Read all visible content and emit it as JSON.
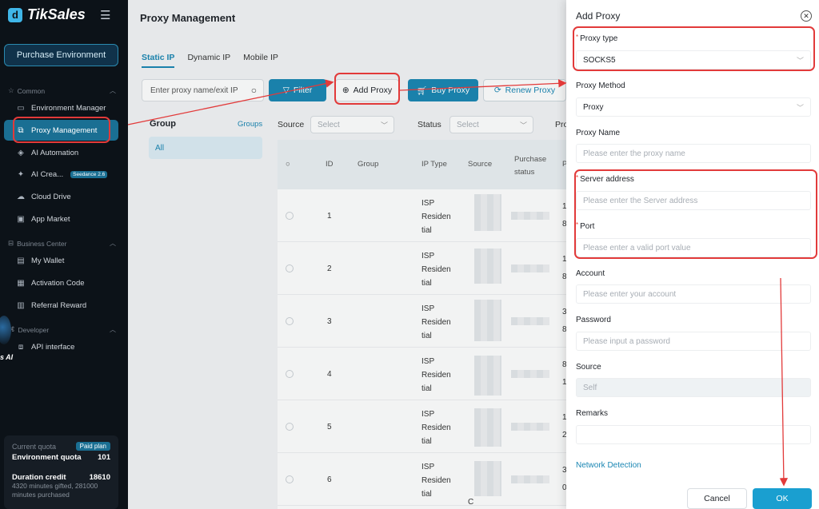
{
  "sidebar": {
    "brand": "TikSales",
    "purchase_button": "Purchase Environment",
    "sections": {
      "common": "Common",
      "business": "Business Center",
      "developer": "Developer"
    },
    "items": {
      "environment": "Environment Manager",
      "proxy": "Proxy Management",
      "ai_automation": "AI Automation",
      "ai_creation": "AI Crea...",
      "ai_creation_badge": "Seedance 2.6",
      "cloud_drive": "Cloud Drive",
      "app_market": "App Market",
      "wallet": "My Wallet",
      "activation": "Activation Code",
      "referral": "Referral Reward",
      "api": "API interface"
    },
    "deco_text": "s AI",
    "quota": {
      "current_label": "Current quota",
      "plan_badge": "Paid plan",
      "env_label": "Environment quota",
      "env_value": "101",
      "duration_label": "Duration credit",
      "duration_value": "18610",
      "duration_detail": "4320 minutes gifted, 281000 minutes purchased"
    }
  },
  "main": {
    "title": "Proxy Management",
    "tabs": [
      "Static IP",
      "Dynamic IP",
      "Mobile IP"
    ],
    "search_placeholder": "Enter proxy name/exit IP",
    "buttons": {
      "filter": "Filter",
      "add_proxy": "Add Proxy",
      "buy_proxy": "Buy Proxy",
      "renew_proxy": "Renew Proxy"
    },
    "group": {
      "title": "Group",
      "link": "Groups",
      "all": "All"
    },
    "filters": {
      "source_label": "Source",
      "source_placeholder": "Select",
      "status_label": "Status",
      "status_placeholder": "Select",
      "pro_label": "Pro"
    },
    "table": {
      "headers": {
        "id": "ID",
        "group": "Group",
        "ip_type": "IP Type",
        "source": "Source",
        "purchase": "Purchase status",
        "p": "P"
      },
      "rows": [
        {
          "id": "1",
          "ip_type": [
            "ISP",
            "Residen",
            "tial"
          ],
          "extra": ""
        },
        {
          "id": "2",
          "ip_type": [
            "ISP",
            "Residen",
            "tial"
          ],
          "extra": ""
        },
        {
          "id": "3",
          "ip_type": [
            "ISP",
            "Residen",
            "tial"
          ],
          "extra": ""
        },
        {
          "id": "4",
          "ip_type": [
            "ISP",
            "Residen",
            "tial"
          ],
          "extra": ""
        },
        {
          "id": "5",
          "ip_type": [
            "ISP",
            "Residen",
            "tial"
          ],
          "extra": ""
        },
        {
          "id": "6",
          "ip_type": [
            "ISP",
            "Residen",
            "tial"
          ],
          "extra": "C"
        }
      ],
      "edge_digits": [
        "1",
        "8",
        "1",
        "8",
        "3",
        "8",
        "8",
        "1",
        "1",
        "2",
        "3",
        "0"
      ]
    }
  },
  "drawer": {
    "title": "Add Proxy",
    "proxy_type": {
      "label": "Proxy type",
      "value": "SOCKS5"
    },
    "proxy_method": {
      "label": "Proxy Method",
      "value": "Proxy"
    },
    "proxy_name": {
      "label": "Proxy Name",
      "placeholder": "Please enter the proxy name"
    },
    "server_address": {
      "label": "Server address",
      "placeholder": "Please enter the Server address"
    },
    "port": {
      "label": "Port",
      "placeholder": "Please enter a valid port value"
    },
    "account": {
      "label": "Account",
      "placeholder": "Please enter your account"
    },
    "password": {
      "label": "Password",
      "placeholder": "Please input a password"
    },
    "source": {
      "label": "Source",
      "value": "Self"
    },
    "remarks": {
      "label": "Remarks",
      "placeholder": ""
    },
    "network_detection": "Network Detection",
    "cancel": "Cancel",
    "ok": "OK"
  },
  "colors": {
    "accent": "#1a86b3",
    "annotation": "#e23a3a",
    "sidebar_bg": "#0c1218"
  }
}
